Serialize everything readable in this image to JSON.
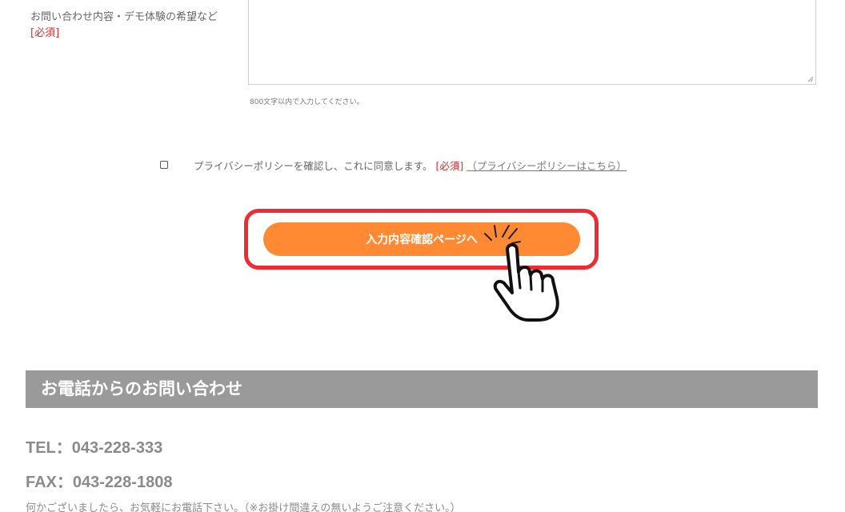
{
  "form": {
    "inquiry_label": "お問い合わせ内容・デモ体験の希望など",
    "required_tag": "[必須]",
    "char_limit_hint": "800文字以内で入力してください。",
    "privacy": {
      "checked": false,
      "text": "プライバシーポリシーを確認し、これに同意します。",
      "required_tag": "[必須]",
      "link_text": "（プライバシーポリシーはこちら）"
    },
    "submit_label": "入力内容確認ページへ"
  },
  "phone_section": {
    "heading": "お電話からのお問い合わせ",
    "tel": "TEL：043-228-333",
    "fax": "FAX：043-228-1808",
    "note": "何かございましたら、お気軽にお電話下さい。（※お掛け間違えの無いようご注意ください。）"
  },
  "colors": {
    "accent_orange": "#ff8a33",
    "highlight_red": "#ee2a33",
    "required_red": "#d9282f",
    "section_gray": "#9a9a9a"
  },
  "icons": {
    "pointer": "hand-pointer-icon"
  }
}
